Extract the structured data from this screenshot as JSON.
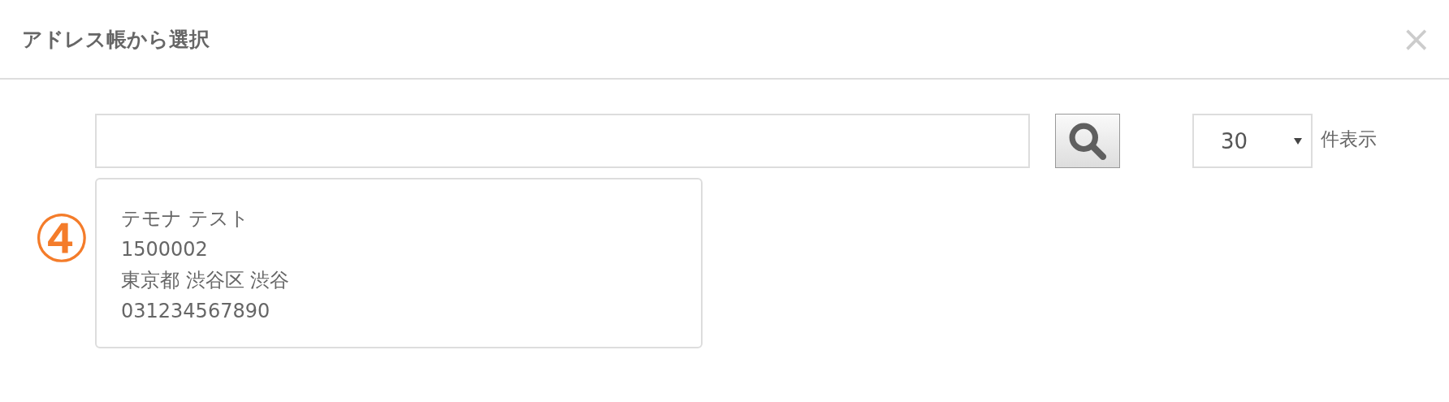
{
  "dialog": {
    "title": "アドレス帳から選択",
    "close": "×"
  },
  "page_size": {
    "value": "30",
    "suffix": "件表示"
  },
  "marker": "④",
  "address_card": {
    "lines": [
      "テモナ テスト",
      "1500002",
      "東京都 渋谷区 渋谷",
      "031234567890"
    ]
  }
}
